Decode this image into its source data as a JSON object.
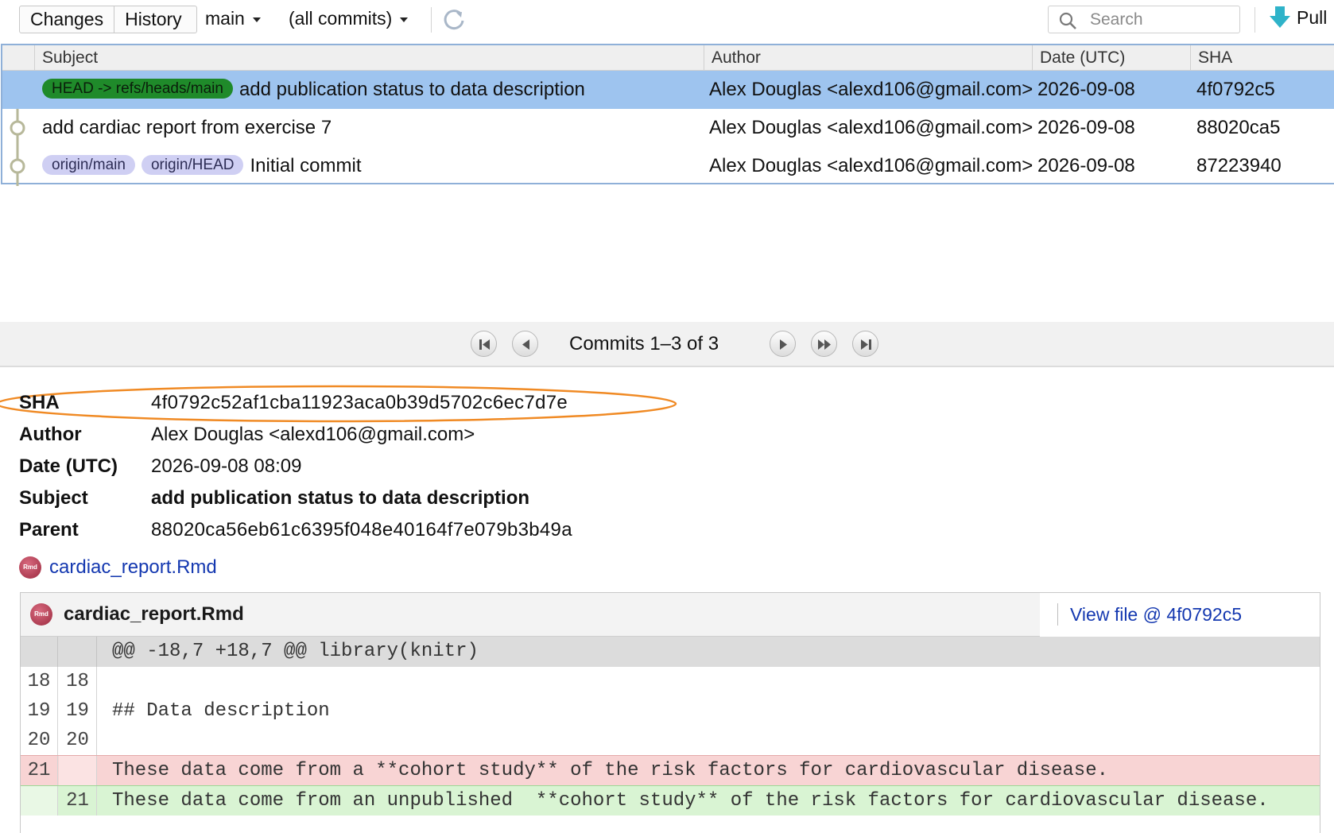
{
  "toolbar": {
    "tabs": [
      "Changes",
      "History"
    ],
    "branch": "main",
    "commit_filter": "(all commits)",
    "search_placeholder": "Search",
    "pull_label": "Pull"
  },
  "table": {
    "columns": [
      "Subject",
      "Author",
      "Date (UTC)",
      "SHA"
    ],
    "rows": [
      {
        "refs": [
          "HEAD -> refs/heads/main"
        ],
        "subject": "add publication status to data description",
        "author": "Alex Douglas <alexd106@gmail.com>",
        "date": "2026-09-08",
        "sha": "4f0792c5"
      },
      {
        "refs": [],
        "subject": "add cardiac report from exercise 7",
        "author": "Alex Douglas <alexd106@gmail.com>",
        "date": "2026-09-08",
        "sha": "88020ca5"
      },
      {
        "refs": [
          "origin/main",
          "origin/HEAD"
        ],
        "subject": "Initial commit",
        "author": "Alex Douglas <alexd106@gmail.com>",
        "date": "2026-09-08",
        "sha": "87223940"
      }
    ]
  },
  "pager": {
    "label": "Commits 1–3 of 3"
  },
  "details": {
    "sha_label": "SHA",
    "sha": "4f0792c52af1cba11923aca0b39d5702c6ec7d7e",
    "author_label": "Author",
    "author": "Alex Douglas <alexd106@gmail.com>",
    "date_label": "Date (UTC)",
    "date": "2026-09-08 08:09",
    "subject_label": "Subject",
    "subject": "add publication status to data description",
    "parent_label": "Parent",
    "parent": "88020ca56eb61c6395f048e40164f7e079b3b49a"
  },
  "files": {
    "link": "cardiac_report.Rmd"
  },
  "diff": {
    "filename": "cardiac_report.Rmd",
    "view_file": "View file @ 4f0792c5",
    "file_icon_text": "Rmd",
    "hunk": "@@ -18,7 +18,7 @@ library(knitr)",
    "lines": [
      {
        "old": "18",
        "new": "18",
        "text": ""
      },
      {
        "old": "19",
        "new": "19",
        "text": "## Data description"
      },
      {
        "old": "20",
        "new": "20",
        "text": ""
      },
      {
        "old": "21",
        "new": "",
        "text": "These data come from a **cohort study** of the risk factors for cardiovascular disease."
      },
      {
        "old": "",
        "new": "21",
        "text": "These data come from an unpublished  **cohort study** of the risk factors for cardiovascular disease."
      }
    ]
  },
  "colors": {
    "selected_row": "#9ec4ef",
    "head_badge": "#1f8a2a",
    "origin_badge": "#cfcff3",
    "highlight_ellipse": "#f08a24",
    "link": "#1438b0"
  }
}
